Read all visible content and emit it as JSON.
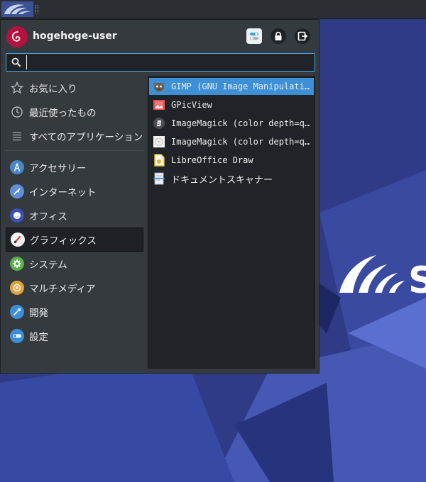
{
  "colors": {
    "desktop_bg": "#2f3b86",
    "menu_bg": "#353a3f",
    "accent": "#3d8fd6",
    "avatar": "#b3123f"
  },
  "user": {
    "name": "hogehoge-user",
    "avatar_icon": "debian-swirl-icon"
  },
  "header_buttons": [
    {
      "name": "settings-icon"
    },
    {
      "name": "lock-icon"
    },
    {
      "name": "logout-icon"
    }
  ],
  "search": {
    "value": "",
    "placeholder": ""
  },
  "categories_top": [
    {
      "label": "お気に入り",
      "icon": "star-icon"
    },
    {
      "label": "最近使ったもの",
      "icon": "clock-icon"
    },
    {
      "label": "すべてのアプリケーション",
      "icon": "list-icon"
    }
  ],
  "categories": [
    {
      "label": "アクセサリー",
      "icon": "accessories-icon"
    },
    {
      "label": "インターネット",
      "icon": "internet-icon"
    },
    {
      "label": "オフィス",
      "icon": "office-icon"
    },
    {
      "label": "グラフィックス",
      "icon": "graphics-icon",
      "selected": true
    },
    {
      "label": "システム",
      "icon": "system-icon"
    },
    {
      "label": "マルチメディア",
      "icon": "multimedia-icon"
    },
    {
      "label": "開発",
      "icon": "development-icon"
    },
    {
      "label": "設定",
      "icon": "settings-icon"
    }
  ],
  "apps": [
    {
      "label": "GIMP (GNU Image Manipulatio…",
      "icon": "gimp-icon",
      "selected": true
    },
    {
      "label": "GPicView",
      "icon": "gpicview-icon"
    },
    {
      "label": "ImageMagick (color depth=q1…",
      "icon": "imagemagick-icon"
    },
    {
      "label": "ImageMagick (color depth=q1…",
      "icon": "imagemagick-doc-icon"
    },
    {
      "label": "LibreOffice Draw",
      "icon": "libreoffice-draw-icon"
    },
    {
      "label": "ドキュメントスキャナー",
      "icon": "document-scanner-icon"
    }
  ],
  "desktop": {
    "logo_text": "S"
  }
}
